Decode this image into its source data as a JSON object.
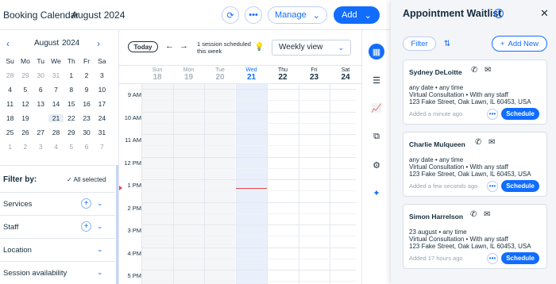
{
  "topbar": {
    "title": "Booking Calendar",
    "month": "August 2024",
    "refresh_icon": "refresh-icon",
    "more_icon": "more-icon",
    "manage_label": "Manage",
    "add_label": "Add"
  },
  "mini_calendar": {
    "month": "August",
    "year": "2024",
    "weekdays": [
      "Su",
      "Mo",
      "Tu",
      "We",
      "Th",
      "Fr",
      "Sa"
    ],
    "weeks": [
      [
        "28",
        "29",
        "30",
        "31",
        "1",
        "2",
        "3"
      ],
      [
        "4",
        "5",
        "6",
        "7",
        "8",
        "9",
        "10"
      ],
      [
        "11",
        "12",
        "13",
        "14",
        "15",
        "16",
        "17"
      ],
      [
        "18",
        "19",
        "20",
        "21",
        "22",
        "23",
        "24"
      ],
      [
        "25",
        "26",
        "27",
        "28",
        "29",
        "30",
        "31"
      ],
      [
        "1",
        "2",
        "3",
        "4",
        "5",
        "6",
        "7"
      ]
    ],
    "selected": "20"
  },
  "filters": {
    "heading": "Filter by:",
    "all_selected": "All selected",
    "items": [
      "Services",
      "Staff",
      "Location",
      "Session availability"
    ]
  },
  "calendar": {
    "today_label": "Today",
    "session_note": "1 session scheduled this week",
    "view_label": "Weekly view",
    "days": [
      {
        "name": "Sun",
        "date": "18"
      },
      {
        "name": "Mon",
        "date": "19"
      },
      {
        "name": "Tue",
        "date": "20"
      },
      {
        "name": "Wed",
        "date": "21"
      },
      {
        "name": "Thu",
        "date": "22"
      },
      {
        "name": "Fri",
        "date": "23"
      },
      {
        "name": "Sat",
        "date": "24"
      }
    ],
    "hours": [
      "9 AM",
      "10 AM",
      "11 AM",
      "12 PM",
      "1 PM",
      "2 PM",
      "3 PM",
      "4 PM",
      "5 PM"
    ]
  },
  "panel": {
    "title": "Appointment Waitlist",
    "filter_label": "Filter",
    "add_new_label": "Add New",
    "schedule_label": "Schedule",
    "cards": [
      {
        "name": "Sydney DeLoitte",
        "when": "any date • any time",
        "service": "Virtual Consultation • With any staff",
        "address": "123 Fake Street, Oak Lawn, IL 60453, USA",
        "added": "Added a minute ago"
      },
      {
        "name": "Charlie Mulqueen",
        "when": "any date • any time",
        "service": "Virtual Consultation • With any staff",
        "address": "123 Fake Street, Oak Lawn, IL 60453, USA",
        "added": "Added a few seconds ago"
      },
      {
        "name": "Simon Harrelson",
        "when": "23 august • any time",
        "service": "Virtual Consultation • With any staff",
        "address": "123 Fake Street, Oak Lawn, IL 60453, USA",
        "added": "Added 17 hours ago"
      }
    ]
  },
  "colors": {
    "accent": "#116dff",
    "now_line": "#e2474b"
  }
}
